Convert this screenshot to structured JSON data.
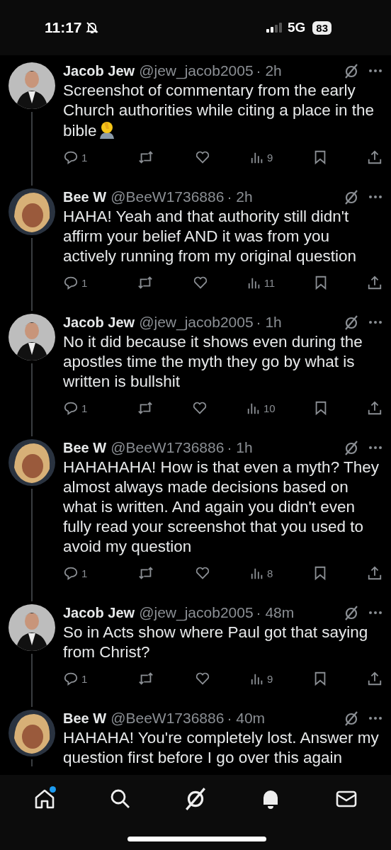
{
  "status_bar": {
    "time": "11:17",
    "network": "5G",
    "battery": "83",
    "silenced": true
  },
  "posts": [
    {
      "author": "Jacob Jew",
      "handle": "@jew_jacob2005",
      "time": "· 2h",
      "text": "Screenshot of commentary from the early Church authorities while citing a place in the bible",
      "facepalm_emoji": true,
      "kind": "suit",
      "replies": "1",
      "views": "9",
      "thread_below": true
    },
    {
      "author": "Bee W",
      "handle": "@BeeW1736886",
      "time": "· 2h",
      "text": "HAHA! Yeah and that authority still didn't affirm your belief AND it was from you actively running from my original question",
      "facepalm_emoji": false,
      "kind": "blond",
      "replies": "1",
      "views": "11",
      "thread_below": true
    },
    {
      "author": "Jacob Jew",
      "handle": "@jew_jacob2005",
      "time": "· 1h",
      "text": "No it did because it shows even during the apostles time the myth they go by what is written is bullshit",
      "facepalm_emoji": false,
      "kind": "suit",
      "replies": "1",
      "views": "10",
      "thread_below": true
    },
    {
      "author": "Bee W",
      "handle": "@BeeW1736886",
      "time": "· 1h",
      "text": "HAHAHAHA! How is that even a myth? They almost always made decisions based on what is written. And again you didn't even fully read your screenshot that you used to avoid my question",
      "facepalm_emoji": false,
      "kind": "blond",
      "replies": "1",
      "views": "8",
      "thread_below": true
    },
    {
      "author": "Jacob Jew",
      "handle": "@jew_jacob2005",
      "time": "· 48m",
      "text": "So in Acts show where Paul got that saying from Christ?",
      "facepalm_emoji": false,
      "kind": "suit",
      "replies": "1",
      "views": "9",
      "thread_below": true
    },
    {
      "author": "Bee W",
      "handle": "@BeeW1736886",
      "time": "· 40m",
      "text": "HAHAHA! You're completely lost. Answer my question first before I go over this again",
      "facepalm_emoji": false,
      "kind": "blond",
      "thread_below": true
    }
  ],
  "nav": [
    {
      "kind": "home",
      "dot": true
    },
    {
      "kind": "search",
      "dot": false
    },
    {
      "kind": "grok",
      "dot": false
    },
    {
      "kind": "bell",
      "dot": false
    },
    {
      "kind": "mail",
      "dot": false
    }
  ]
}
